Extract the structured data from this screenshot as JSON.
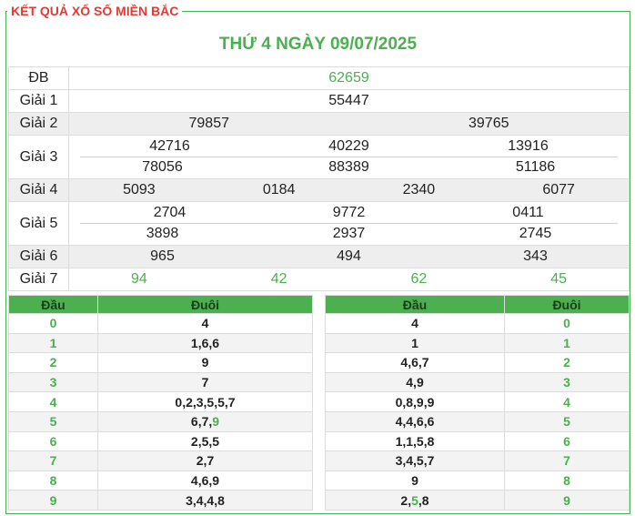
{
  "header": {
    "title": "KẾT QUẢ XỔ SỐ MIỀN BẮC",
    "date_title": "THỨ 4 NGÀY 09/07/2025"
  },
  "results": {
    "db": {
      "label": "ĐB",
      "values": [
        "62659"
      ]
    },
    "g1": {
      "label": "Giải 1",
      "values": [
        "55447"
      ]
    },
    "g2": {
      "label": "Giải 2",
      "values": [
        "79857",
        "39765"
      ]
    },
    "g3": {
      "label": "Giải 3",
      "rows": [
        [
          "42716",
          "40229",
          "13916"
        ],
        [
          "78056",
          "88389",
          "51186"
        ]
      ]
    },
    "g4": {
      "label": "Giải 4",
      "values": [
        "5093",
        "0184",
        "2340",
        "6077"
      ]
    },
    "g5": {
      "label": "Giải 5",
      "rows": [
        [
          "2704",
          "9772",
          "0411"
        ],
        [
          "3898",
          "2937",
          "2745"
        ]
      ]
    },
    "g6": {
      "label": "Giải 6",
      "values": [
        "965",
        "494",
        "343"
      ]
    },
    "g7": {
      "label": "Giải 7",
      "values": [
        "94",
        "42",
        "62",
        "45"
      ]
    }
  },
  "dau_table": {
    "headers": [
      "Đầu",
      "Đuôi"
    ],
    "rows": [
      [
        "0",
        "4"
      ],
      [
        "1",
        "1,6,6"
      ],
      [
        "2",
        "9"
      ],
      [
        "3",
        "7"
      ],
      [
        "4",
        "0,2,3,5,5,7"
      ],
      [
        "5",
        "6,7,9"
      ],
      [
        "6",
        "2,5,5"
      ],
      [
        "7",
        "2,7"
      ],
      [
        "8",
        "4,6,9"
      ],
      [
        "9",
        "3,4,4,8"
      ]
    ]
  },
  "duoi_table": {
    "headers": [
      "Đầu",
      "Đuôi"
    ],
    "rows": [
      [
        "4",
        "0"
      ],
      [
        "1",
        "1"
      ],
      [
        "4,6,7",
        "2"
      ],
      [
        "4,9",
        "3"
      ],
      [
        "0,8,9,9",
        "4"
      ],
      [
        "4,4,6,6",
        "5"
      ],
      [
        "1,1,5,8",
        "6"
      ],
      [
        "3,4,5,7",
        "7"
      ],
      [
        "9",
        "8"
      ],
      [
        "2,5,8",
        "9"
      ]
    ]
  },
  "colors": {
    "accent": "#4caf50",
    "heading": "#e53935"
  }
}
